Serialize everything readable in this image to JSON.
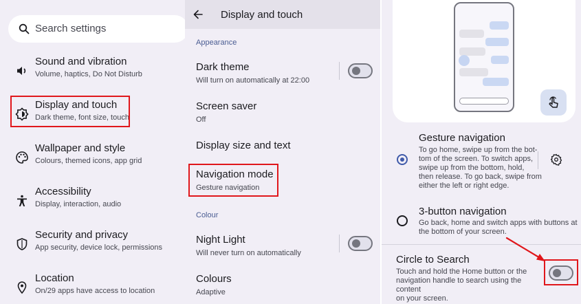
{
  "settings": {
    "search_placeholder": "Search settings",
    "items": [
      {
        "title": "Sound and vibration",
        "subtitle": "Volume, haptics, Do Not Disturb",
        "icon": "speaker-icon"
      },
      {
        "title": "Display and touch",
        "subtitle": "Dark theme, font size, touch",
        "icon": "brightness-icon"
      },
      {
        "title": "Wallpaper and style",
        "subtitle": "Colours, themed icons, app grid",
        "icon": "palette-icon"
      },
      {
        "title": "Accessibility",
        "subtitle": "Display, interaction, audio",
        "icon": "accessibility-icon"
      },
      {
        "title": "Security and privacy",
        "subtitle": "App security, device lock, permissions",
        "icon": "shield-icon"
      },
      {
        "title": "Location",
        "subtitle": "On/29 apps have access to location",
        "icon": "location-pin-icon"
      }
    ]
  },
  "display": {
    "header_title": "Display and touch",
    "section_appearance": "Appearance",
    "section_colour": "Colour",
    "dark_theme": {
      "title": "Dark theme",
      "subtitle": "Will turn on automatically at 22:00",
      "toggle_on": false
    },
    "screen_saver": {
      "title": "Screen saver",
      "subtitle": "Off"
    },
    "display_size": {
      "title": "Display size and text"
    },
    "navigation_mode": {
      "title": "Navigation mode",
      "subtitle": "Gesture navigation"
    },
    "night_light": {
      "title": "Night Light",
      "subtitle": "Will never turn on automatically",
      "toggle_on": false
    },
    "colours": {
      "title": "Colours",
      "subtitle": "Adaptive"
    }
  },
  "navigation": {
    "gesture": {
      "title": "Gesture navigation",
      "lines": [
        "To go home, swipe up from the bot-",
        "tom of the screen. To switch apps,",
        "swipe up from the bottom, hold,",
        "then release. To go back, swipe from",
        "either the left or right edge."
      ],
      "selected": true
    },
    "three_button": {
      "title": "3-button navigation",
      "lines": [
        "Go back, home and switch apps with buttons at",
        "the bottom of your screen."
      ],
      "selected": false
    },
    "circle_to_search": {
      "title": "Circle to Search",
      "lines": [
        "Touch and hold the Home button or the",
        "navigation handle to search using the content",
        "on your screen."
      ],
      "toggle_on": false
    }
  },
  "colors": {
    "highlight_red": "#e0161b",
    "accent_blue": "#3f5aa9",
    "panel_bg": "#f1eef6"
  }
}
